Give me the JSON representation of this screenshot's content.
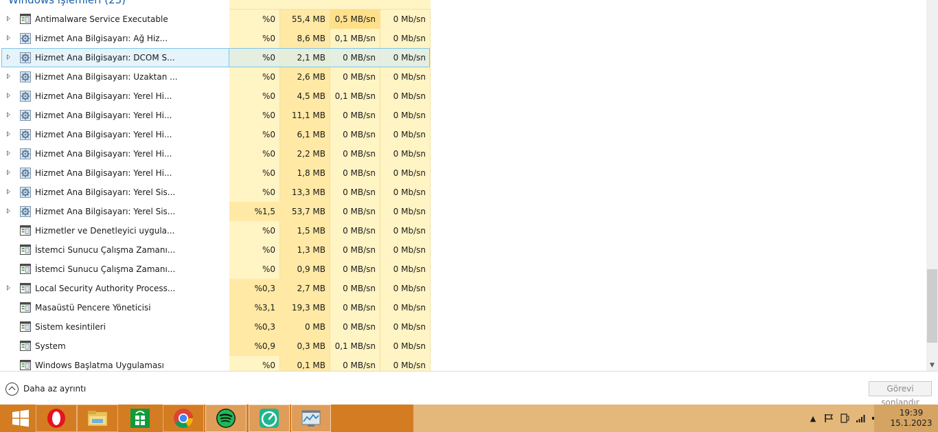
{
  "group_header": "Windows işlemleri (23)",
  "processes": [
    {
      "name": "Antimalware Service Executable",
      "icon": "app-window-icon",
      "expandable": true,
      "selected": false,
      "cpu": "%0",
      "memory": "55,4 MB",
      "disk": "0,5 MB/sn",
      "network": "0 Mb/sn"
    },
    {
      "name": "Hizmet Ana Bilgisayarı: Ağ Hiz...",
      "icon": "gear-icon",
      "expandable": true,
      "selected": false,
      "cpu": "%0",
      "memory": "8,6 MB",
      "disk": "0,1 MB/sn",
      "network": "0 Mb/sn"
    },
    {
      "name": "Hizmet Ana Bilgisayarı: DCOM S...",
      "icon": "gear-icon",
      "expandable": true,
      "selected": true,
      "cpu": "%0",
      "memory": "2,1 MB",
      "disk": "0 MB/sn",
      "network": "0 Mb/sn"
    },
    {
      "name": "Hizmet Ana Bilgisayarı: Uzaktan ...",
      "icon": "gear-icon",
      "expandable": true,
      "selected": false,
      "cpu": "%0",
      "memory": "2,6 MB",
      "disk": "0 MB/sn",
      "network": "0 Mb/sn"
    },
    {
      "name": "Hizmet Ana Bilgisayarı: Yerel Hi...",
      "icon": "gear-icon",
      "expandable": true,
      "selected": false,
      "cpu": "%0",
      "memory": "4,5 MB",
      "disk": "0,1 MB/sn",
      "network": "0 Mb/sn"
    },
    {
      "name": "Hizmet Ana Bilgisayarı: Yerel Hi...",
      "icon": "gear-icon",
      "expandable": true,
      "selected": false,
      "cpu": "%0",
      "memory": "11,1 MB",
      "disk": "0 MB/sn",
      "network": "0 Mb/sn"
    },
    {
      "name": "Hizmet Ana Bilgisayarı: Yerel Hi...",
      "icon": "gear-icon",
      "expandable": true,
      "selected": false,
      "cpu": "%0",
      "memory": "6,1 MB",
      "disk": "0 MB/sn",
      "network": "0 Mb/sn"
    },
    {
      "name": "Hizmet Ana Bilgisayarı: Yerel Hi...",
      "icon": "gear-icon",
      "expandable": true,
      "selected": false,
      "cpu": "%0",
      "memory": "2,2 MB",
      "disk": "0 MB/sn",
      "network": "0 Mb/sn"
    },
    {
      "name": "Hizmet Ana Bilgisayarı: Yerel Hi...",
      "icon": "gear-icon",
      "expandable": true,
      "selected": false,
      "cpu": "%0",
      "memory": "1,8 MB",
      "disk": "0 MB/sn",
      "network": "0 Mb/sn"
    },
    {
      "name": "Hizmet Ana Bilgisayarı: Yerel Sis...",
      "icon": "gear-icon",
      "expandable": true,
      "selected": false,
      "cpu": "%0",
      "memory": "13,3 MB",
      "disk": "0 MB/sn",
      "network": "0 Mb/sn"
    },
    {
      "name": "Hizmet Ana Bilgisayarı: Yerel Sis...",
      "icon": "gear-icon",
      "expandable": true,
      "selected": false,
      "cpu": "%1,5",
      "memory": "53,7 MB",
      "disk": "0 MB/sn",
      "network": "0 Mb/sn"
    },
    {
      "name": "Hizmetler ve Denetleyici uygula...",
      "icon": "app-window-icon",
      "expandable": false,
      "selected": false,
      "cpu": "%0",
      "memory": "1,5 MB",
      "disk": "0 MB/sn",
      "network": "0 Mb/sn"
    },
    {
      "name": "İstemci Sunucu Çalışma Zamanı...",
      "icon": "app-window-icon",
      "expandable": false,
      "selected": false,
      "cpu": "%0",
      "memory": "1,3 MB",
      "disk": "0 MB/sn",
      "network": "0 Mb/sn"
    },
    {
      "name": "İstemci Sunucu Çalışma Zamanı...",
      "icon": "app-window-icon",
      "expandable": false,
      "selected": false,
      "cpu": "%0",
      "memory": "0,9 MB",
      "disk": "0 MB/sn",
      "network": "0 Mb/sn"
    },
    {
      "name": "Local Security Authority Process...",
      "icon": "app-window-icon",
      "expandable": true,
      "selected": false,
      "cpu": "%0,3",
      "memory": "2,7 MB",
      "disk": "0 MB/sn",
      "network": "0 Mb/sn"
    },
    {
      "name": "Masaüstü Pencere Yöneticisi",
      "icon": "app-window-icon",
      "expandable": false,
      "selected": false,
      "cpu": "%3,1",
      "memory": "19,3 MB",
      "disk": "0 MB/sn",
      "network": "0 Mb/sn"
    },
    {
      "name": "Sistem kesintileri",
      "icon": "app-window-icon",
      "expandable": false,
      "selected": false,
      "cpu": "%0,3",
      "memory": "0 MB",
      "disk": "0 MB/sn",
      "network": "0 Mb/sn"
    },
    {
      "name": "System",
      "icon": "app-window-icon",
      "expandable": false,
      "selected": false,
      "cpu": "%0,9",
      "memory": "0,3 MB",
      "disk": "0,1 MB/sn",
      "network": "0 Mb/sn"
    },
    {
      "name": "Windows Başlatma Uygulaması",
      "icon": "app-window-icon",
      "expandable": false,
      "selected": false,
      "cpu": "%0",
      "memory": "0,1 MB",
      "disk": "0 MB/sn",
      "network": "0 Mb/sn"
    }
  ],
  "footer": {
    "less_details_label": "Daha az ayrıntı",
    "end_task_label": "Görevi sonlandır"
  },
  "taskbar": {
    "apps": [
      {
        "name": "start-button",
        "icon": "windows-logo-icon"
      },
      {
        "name": "opera",
        "icon": "opera-icon"
      },
      {
        "name": "file-explorer",
        "icon": "folder-icon"
      },
      {
        "name": "store",
        "icon": "store-icon"
      },
      {
        "name": "chrome",
        "icon": "chrome-icon"
      },
      {
        "name": "spotify",
        "icon": "spotify-icon"
      },
      {
        "name": "app-green",
        "icon": "gauge-icon"
      },
      {
        "name": "task-manager",
        "icon": "task-manager-icon"
      }
    ],
    "clock_time": "19:39",
    "clock_date": "15.1.2023"
  },
  "colors": {
    "cpu_col": "#fff4c4",
    "mem_col": "#ffe9a5",
    "disk_hot": "#ffe08a",
    "accent": "#1b5fa8",
    "taskbar_left": "#d47c22",
    "taskbar_right": "#e4b77a"
  }
}
